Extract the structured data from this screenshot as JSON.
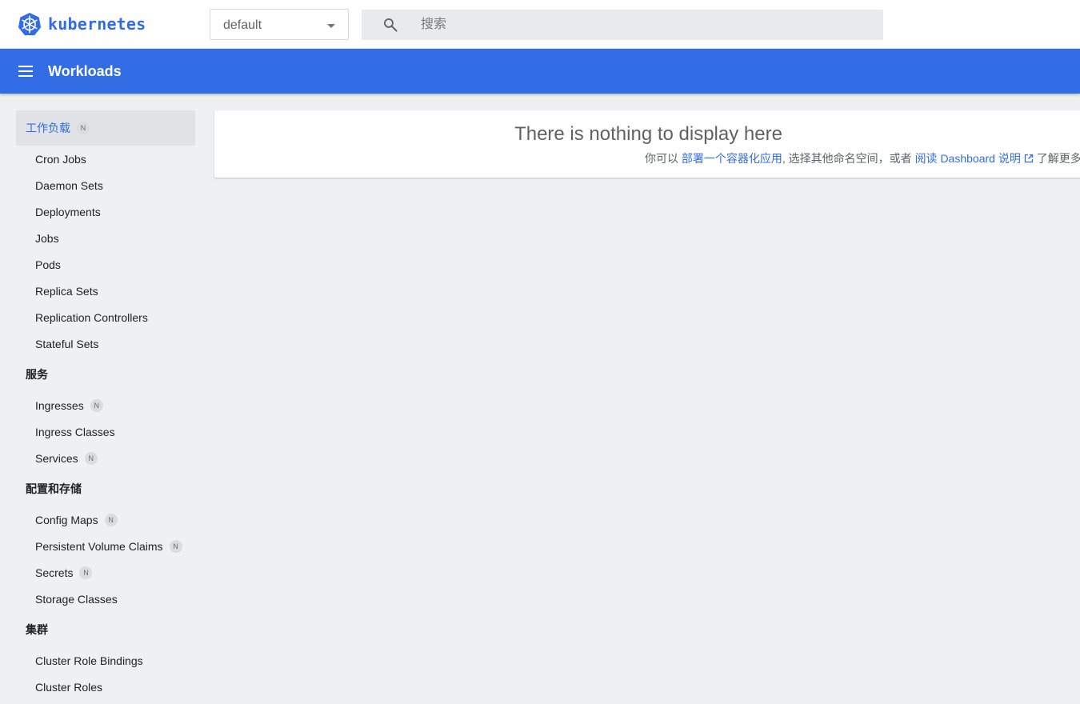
{
  "app": {
    "logo_text": "kubernetes"
  },
  "namespace": {
    "value": "default"
  },
  "search": {
    "placeholder": "搜索"
  },
  "toolbar": {
    "title": "Workloads"
  },
  "sidebar": {
    "workloads_header": "工作负载",
    "workloads_badge": "N",
    "workloads_items": [
      "Cron Jobs",
      "Daemon Sets",
      "Deployments",
      "Jobs",
      "Pods",
      "Replica Sets",
      "Replication Controllers",
      "Stateful Sets"
    ],
    "services_header": "服务",
    "services_items": [
      {
        "label": "Ingresses",
        "badge": "N"
      },
      {
        "label": "Ingress Classes"
      },
      {
        "label": "Services",
        "badge": "N"
      }
    ],
    "config_header": "配置和存储",
    "config_items": [
      {
        "label": "Config Maps",
        "badge": "N"
      },
      {
        "label": "Persistent Volume Claims",
        "badge": "N"
      },
      {
        "label": "Secrets",
        "badge": "N"
      },
      {
        "label": "Storage Classes"
      }
    ],
    "cluster_header": "集群",
    "cluster_items": [
      "Cluster Role Bindings",
      "Cluster Roles"
    ]
  },
  "empty_state": {
    "title": "There is nothing to display here",
    "text_prefix": "你可以 ",
    "deploy_link": "部署一个容器化应用",
    "text_middle": ", 选择其他命名空间，或者 ",
    "docs_link": "阅读 Dashboard 说明",
    "text_suffix": " 了解更多。"
  },
  "colors": {
    "brand_blue": "#326ce5",
    "toolbar_blue": "#326de6"
  }
}
